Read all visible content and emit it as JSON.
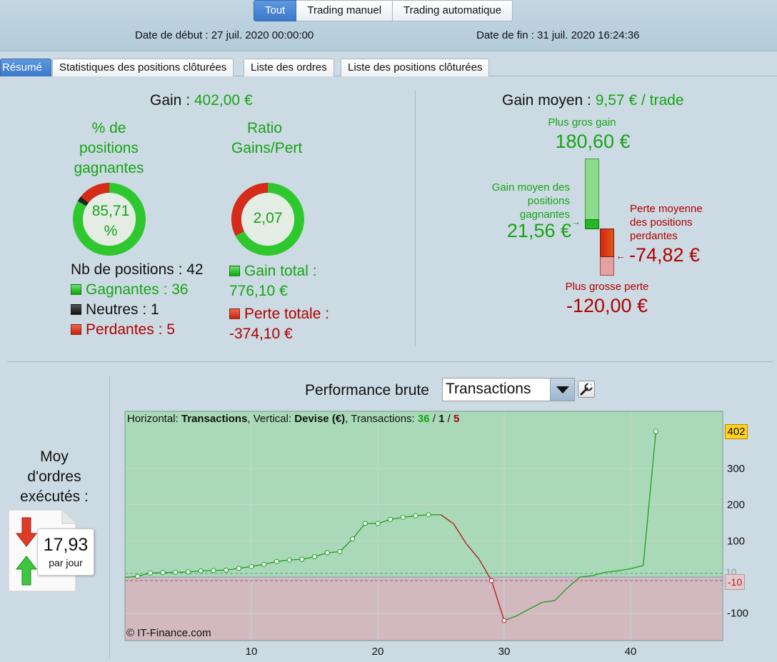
{
  "header": {
    "mode_tabs": [
      "Tout",
      "Trading manuel",
      "Trading automatique"
    ],
    "start_date": "Date de début : 27 juil. 2020 00:00:00",
    "end_date": "Date de fin : 31 juil. 2020 16:24:36"
  },
  "section_tabs": [
    "Résumé",
    "Statistiques des positions clôturées",
    "Liste des ordres",
    "Liste des positions clôturées"
  ],
  "summary": {
    "gain_label": "Gain :",
    "gain_value": "402,00 €",
    "win_pct_title": [
      "% de",
      "positions",
      "gagnantes"
    ],
    "win_pct_value": [
      "85,71",
      "%"
    ],
    "win_pct_fraction": 0.8571,
    "neutral_fraction": 0.0238,
    "ratio_title": [
      "Ratio",
      "Gains/Pert"
    ],
    "ratio_value": "2,07",
    "ratio_gain_fraction": 0.6747,
    "nb_positions": "Nb de positions : 42",
    "winners": "Gagnantes : 36",
    "neutrals": "Neutres : 1",
    "losers": "Perdantes : 5",
    "total_gain_label": "Gain total :",
    "total_gain_value": "776,10 €",
    "total_loss_label": "Perte totale :",
    "total_loss_value": "-374,10 €"
  },
  "average": {
    "title_label": "Gain moyen :",
    "title_value": "9,57 € / trade",
    "max_gain_label": "Plus gros gain",
    "max_gain_value": "180,60 €",
    "avg_win_label": [
      "Gain moyen des",
      "positions",
      "gagnantes"
    ],
    "avg_win_value": "21,56 €",
    "avg_loss_label": [
      "Perte moyenne",
      "des positions",
      "perdantes"
    ],
    "avg_loss_value": "-74,82 €",
    "max_loss_label": "Plus grosse perte",
    "max_loss_value": "-120,00 €"
  },
  "daily": {
    "title": [
      "Moy",
      "d'ordres",
      "exécutés :"
    ],
    "value": "17,93",
    "unit": "par jour"
  },
  "performance": {
    "title": "Performance brute",
    "select_value": "Transactions",
    "info_prefix_1": "Horizontal: ",
    "info_bold_1": "Transactions",
    "info_prefix_2": ", Vertical: ",
    "info_bold_2": "Devise (€)",
    "info_prefix_3": ", Transactions: ",
    "info_wins": "36",
    "info_sep": " / ",
    "info_neutral": "1",
    "info_losses": "5",
    "copyright": "© IT-Finance.com",
    "last_value_label": "402",
    "zero_label": "10",
    "neg_label": "-10"
  },
  "colors": {
    "green": "#17a317",
    "red": "#b00000",
    "accent": "#3a78c9",
    "plot_positive": "#a9d9b8",
    "plot_negative": "#d2b8bf"
  },
  "chart_data": {
    "type": "line",
    "xlabel": "",
    "ylabel": "",
    "xlim": [
      0,
      47
    ],
    "ylim": [
      -160,
      450
    ],
    "x_ticks": [
      10,
      20,
      30,
      40
    ],
    "y_ticks": [
      300,
      200,
      100,
      -100
    ],
    "grid": true,
    "x": [
      0,
      1,
      2,
      3,
      4,
      5,
      6,
      7,
      8,
      9,
      10,
      11,
      12,
      13,
      14,
      15,
      16,
      17,
      18,
      19,
      20,
      21,
      22,
      23,
      24,
      25,
      26,
      27,
      28,
      29,
      30,
      31,
      32,
      33,
      34,
      35,
      36,
      37,
      38,
      39,
      40,
      41,
      42
    ],
    "values": [
      -1,
      2,
      11,
      12,
      13,
      14,
      17,
      18,
      19,
      24,
      29,
      35,
      43,
      47,
      49,
      56,
      67,
      70,
      105,
      148,
      148,
      159,
      165,
      169,
      172,
      172,
      147,
      92,
      50,
      -10,
      -120,
      -107,
      -88,
      -70,
      -65,
      -30,
      0,
      4,
      13,
      17,
      23,
      32,
      402
    ],
    "marker_points": [
      1,
      2,
      3,
      4,
      5,
      6,
      7,
      8,
      9,
      10,
      11,
      12,
      13,
      14,
      15,
      16,
      17,
      18,
      19,
      20,
      21,
      22,
      23,
      24,
      29,
      30,
      42
    ],
    "reference_lines": [
      10,
      -10
    ]
  }
}
